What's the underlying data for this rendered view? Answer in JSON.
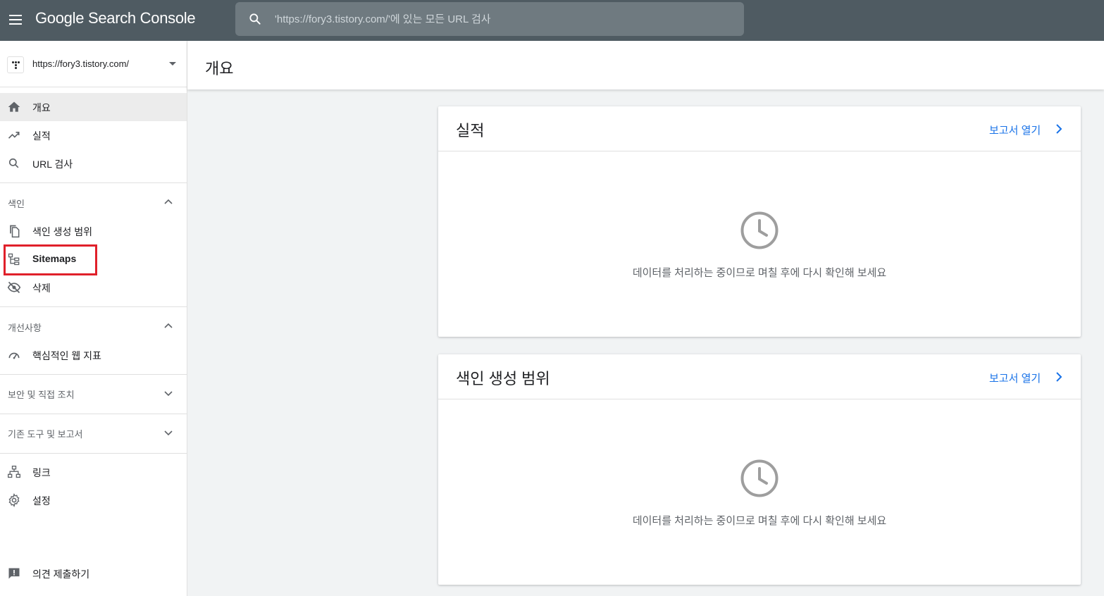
{
  "app": {
    "brand": "Google Search Console",
    "menu_icon": "menu-icon"
  },
  "search": {
    "placeholder": "'https://fory3.tistory.com/'에 있는 모든 URL 검사",
    "value": "",
    "icon": "search-icon"
  },
  "property": {
    "url": "https://fory3.tistory.com/"
  },
  "sidebar": {
    "items": [
      {
        "label": "개요",
        "icon": "home-icon",
        "active": true
      },
      {
        "label": "실적",
        "icon": "trending-up-icon"
      },
      {
        "label": "URL 검사",
        "icon": "search-icon"
      }
    ],
    "index_section": {
      "label": "색인",
      "expanded": true,
      "items": [
        {
          "label": "색인 생성 범위",
          "icon": "copy-icon"
        },
        {
          "label": "Sitemaps",
          "icon": "sitemap-icon",
          "highlighted": true
        },
        {
          "label": "삭제",
          "icon": "eye-off-icon"
        }
      ]
    },
    "enhancements_section": {
      "label": "개선사항",
      "expanded": true,
      "items": [
        {
          "label": "핵심적인 웹 지표",
          "icon": "speed-icon"
        }
      ]
    },
    "security_section": {
      "label": "보안 및 직접 조치",
      "expanded": false
    },
    "legacy_section": {
      "label": "기존 도구 및 보고서",
      "expanded": false
    },
    "bottom_items": [
      {
        "label": "링크",
        "icon": "link-tree-icon"
      },
      {
        "label": "설정",
        "icon": "settings-icon"
      }
    ],
    "feedback": {
      "label": "의견 제출하기",
      "icon": "feedback-icon"
    }
  },
  "main": {
    "title": "개요",
    "cards": [
      {
        "title": "실적",
        "link": "보고서 열기",
        "message": "데이터를 처리하는 중이므로 며칠 후에 다시 확인해 보세요",
        "icon": "clock-icon"
      },
      {
        "title": "색인 생성 범위",
        "link": "보고서 열기",
        "message": "데이터를 처리하는 중이므로 며칠 후에 다시 확인해 보세요",
        "icon": "clock-icon"
      }
    ]
  },
  "colors": {
    "topbar": "#4f5b62",
    "link": "#1a73e8",
    "highlight_border": "#e0202a",
    "active_item": "#ececec"
  }
}
